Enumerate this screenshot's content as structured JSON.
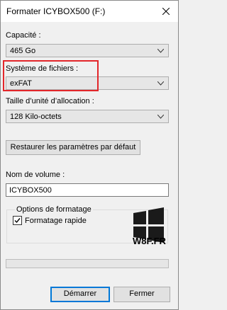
{
  "window": {
    "title": "Formater ICYBOX500 (F:)"
  },
  "capacity": {
    "label": "Capacité :",
    "value": "465 Go"
  },
  "filesystem": {
    "label": "Système de fichiers :",
    "value": "exFAT"
  },
  "allocation": {
    "label": "Taille d’unité d’allocation :",
    "value": "128 Kilo-octets"
  },
  "restore_button": "Restaurer les paramètres par défaut",
  "volume": {
    "label": "Nom de volume :",
    "value": "ICYBOX500"
  },
  "options": {
    "title": "Options de formatage",
    "quick_format_label": "Formatage rapide",
    "quick_format_checked": true
  },
  "watermark": {
    "text": "W8F.FR"
  },
  "progress": {
    "value": 0
  },
  "buttons": {
    "start": "Démarrer",
    "close": "Fermer"
  },
  "colors": {
    "highlight": "#e3262a",
    "accent": "#0078d7"
  }
}
